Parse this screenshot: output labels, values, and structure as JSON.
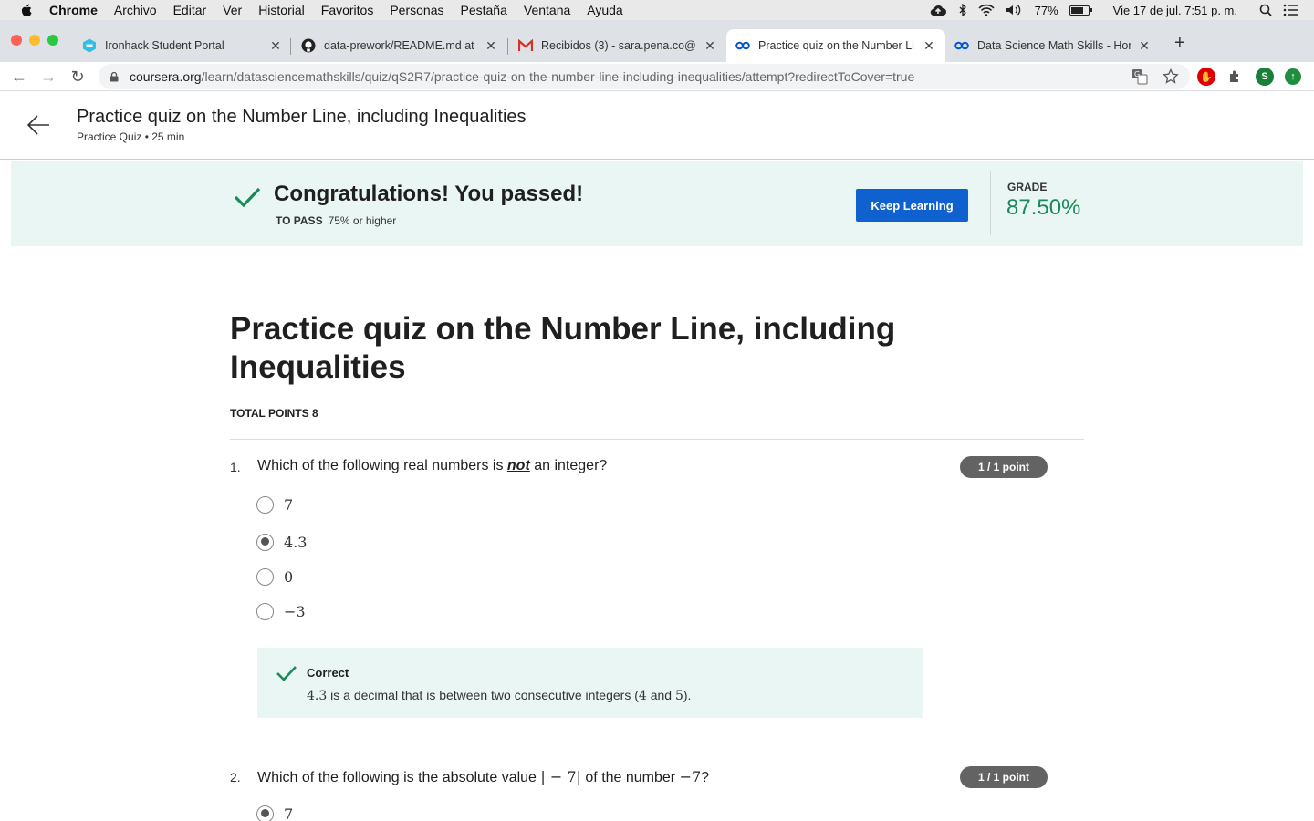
{
  "menubar": {
    "app": "Chrome",
    "items": [
      "Archivo",
      "Editar",
      "Ver",
      "Historial",
      "Favoritos",
      "Personas",
      "Pestaña",
      "Ventana",
      "Ayuda"
    ],
    "battery": "77%",
    "battery_level": 0.77,
    "datetime": "Vie 17 de jul.  7:51 p. m."
  },
  "tabs": [
    {
      "title": "Ironhack Student Portal",
      "icon": "ironhack-icon",
      "active": false
    },
    {
      "title": "data-prework/README.md at m",
      "icon": "github-icon",
      "active": false
    },
    {
      "title": "Recibidos (3) - sara.pena.co@",
      "icon": "gmail-icon",
      "active": false
    },
    {
      "title": "Practice quiz on the Number Li",
      "icon": "coursera-icon",
      "active": true
    },
    {
      "title": "Data Science Math Skills - Hom",
      "icon": "coursera-icon",
      "active": false
    }
  ],
  "address": {
    "host": "coursera.org",
    "path": "/learn/datasciencemathskills/quiz/qS2R7/practice-quiz-on-the-number-line-including-inequalities/attempt?redirectToCover=true"
  },
  "extensions": {
    "profile_letter": "S"
  },
  "header": {
    "title": "Practice quiz on the Number Line, including Inequalities",
    "subtitle": "Practice Quiz • 25 min"
  },
  "banner": {
    "headline": "Congratulations! You passed!",
    "to_pass_label": "TO PASS",
    "to_pass_value": "75% or higher",
    "button": "Keep Learning",
    "grade_label": "GRADE",
    "grade_value": "87.50%"
  },
  "quiz": {
    "title": "Practice quiz on the Number Line, including Inequalities",
    "total_points": "TOTAL POINTS 8",
    "questions": [
      {
        "num": "1.",
        "text_before": "Which of the following real numbers is ",
        "text_emph": "not",
        "text_after": " an integer?",
        "score": "1 / 1 point",
        "options": [
          "7",
          "4.3",
          "0",
          "−3"
        ],
        "selected_index": 1,
        "feedback": {
          "status": "Correct",
          "val1": "4.3",
          "part1": " is a decimal that is between two consecutive integers (",
          "val2": "4",
          "part2": " and ",
          "val3": "5",
          "part3": ")."
        }
      },
      {
        "num": "2.",
        "text_before": "Which of the following is the absolute value ",
        "math1": "| − 7|",
        "text_mid": " of the number ",
        "math2": "−7",
        "text_after": "?",
        "score": "1 / 1 point",
        "options": [
          "7"
        ],
        "selected_index": 0
      }
    ]
  },
  "colors": {
    "banner_bg": "#eaf6f3",
    "button_blue": "#0f61d0",
    "grade_green": "#1a8a5a",
    "check_green": "#1a8a5a",
    "pill_gray": "#636363"
  }
}
